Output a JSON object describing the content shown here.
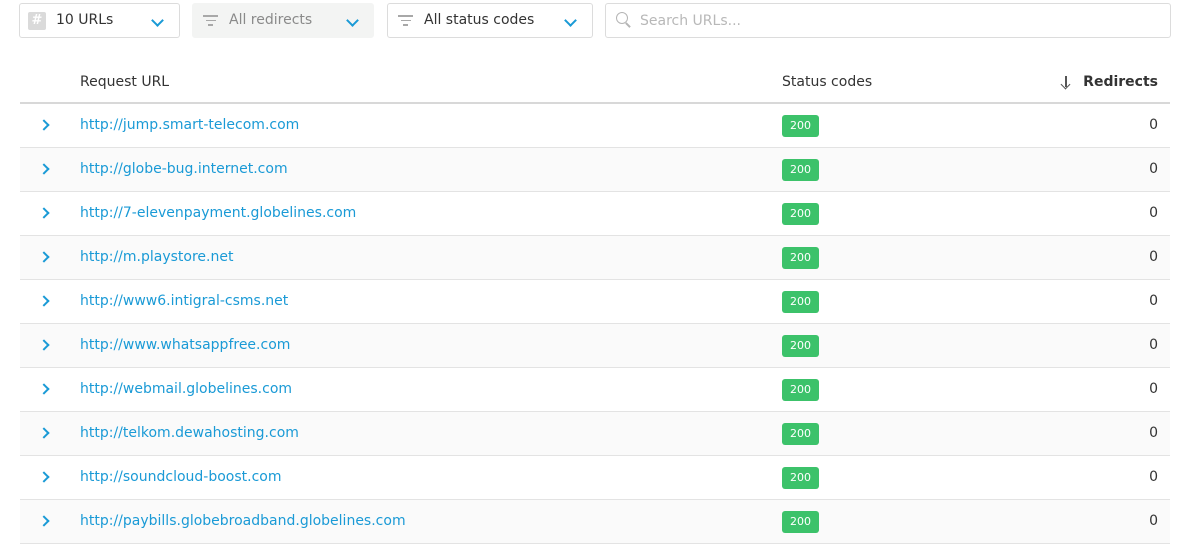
{
  "toolbar": {
    "count_label": "10 URLs",
    "redirects_filter": "All redirects",
    "status_filter": "All status codes",
    "search_placeholder": "Search URLs..."
  },
  "table": {
    "columns": {
      "url": "Request URL",
      "status": "Status codes",
      "redirects": "Redirects"
    },
    "rows": [
      {
        "url": "http://jump.smart-telecom.com",
        "status": "200",
        "redirects": "0"
      },
      {
        "url": "http://globe-bug.internet.com",
        "status": "200",
        "redirects": "0"
      },
      {
        "url": "http://7-elevenpayment.globelines.com",
        "status": "200",
        "redirects": "0"
      },
      {
        "url": "http://m.playstore.net",
        "status": "200",
        "redirects": "0"
      },
      {
        "url": "http://www6.intigral-csms.net",
        "status": "200",
        "redirects": "0"
      },
      {
        "url": "http://www.whatsappfree.com",
        "status": "200",
        "redirects": "0"
      },
      {
        "url": "http://webmail.globelines.com",
        "status": "200",
        "redirects": "0"
      },
      {
        "url": "http://telkom.dewahosting.com",
        "status": "200",
        "redirects": "0"
      },
      {
        "url": "http://soundcloud-boost.com",
        "status": "200",
        "redirects": "0"
      },
      {
        "url": "http://paybills.globebroadband.globelines.com",
        "status": "200",
        "redirects": "0"
      }
    ]
  },
  "colors": {
    "accent": "#1a9ad6",
    "status_ok": "#3cc26a"
  }
}
